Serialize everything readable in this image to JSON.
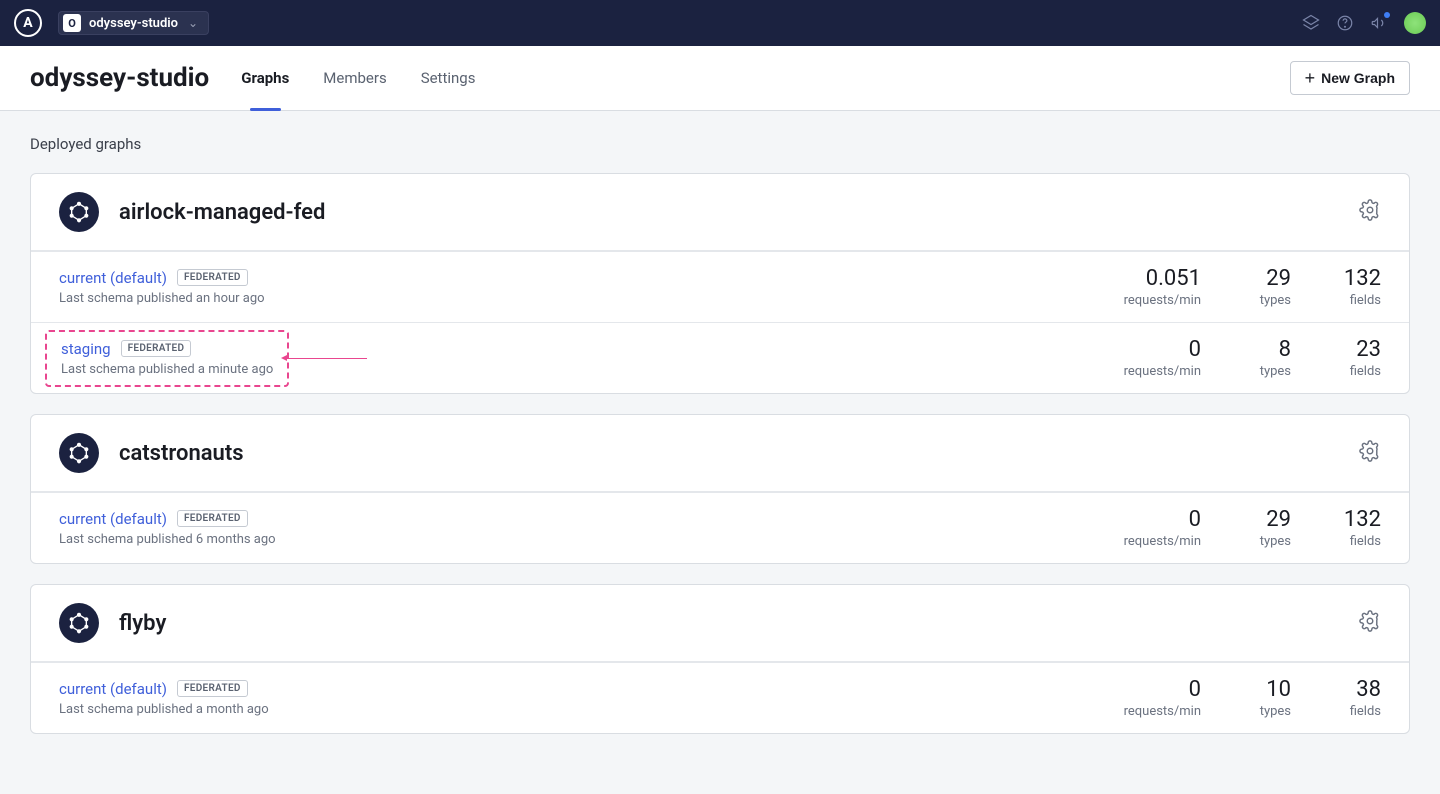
{
  "topbar": {
    "logo_letter": "A",
    "org_badge": "O",
    "org_name": "odyssey-studio"
  },
  "subheader": {
    "title": "odyssey-studio",
    "tabs": [
      {
        "label": "Graphs"
      },
      {
        "label": "Members"
      },
      {
        "label": "Settings"
      }
    ],
    "new_button": "New Graph"
  },
  "section_label": "Deployed graphs",
  "stat_labels": {
    "requests": "requests/min",
    "types": "types",
    "fields": "fields"
  },
  "federated_badge": "FEDERATED",
  "graphs": [
    {
      "name": "airlock-managed-fed",
      "variants": [
        {
          "name": "current (default)",
          "sub": "Last schema published an hour ago",
          "rpm": "0.051",
          "types": "29",
          "fields": "132"
        },
        {
          "name": "staging",
          "sub": "Last schema published a minute ago",
          "rpm": "0",
          "types": "8",
          "fields": "23"
        }
      ]
    },
    {
      "name": "catstronauts",
      "variants": [
        {
          "name": "current (default)",
          "sub": "Last schema published 6 months ago",
          "rpm": "0",
          "types": "29",
          "fields": "132"
        }
      ]
    },
    {
      "name": "flyby",
      "variants": [
        {
          "name": "current (default)",
          "sub": "Last schema published a month ago",
          "rpm": "0",
          "types": "10",
          "fields": "38"
        }
      ]
    }
  ]
}
